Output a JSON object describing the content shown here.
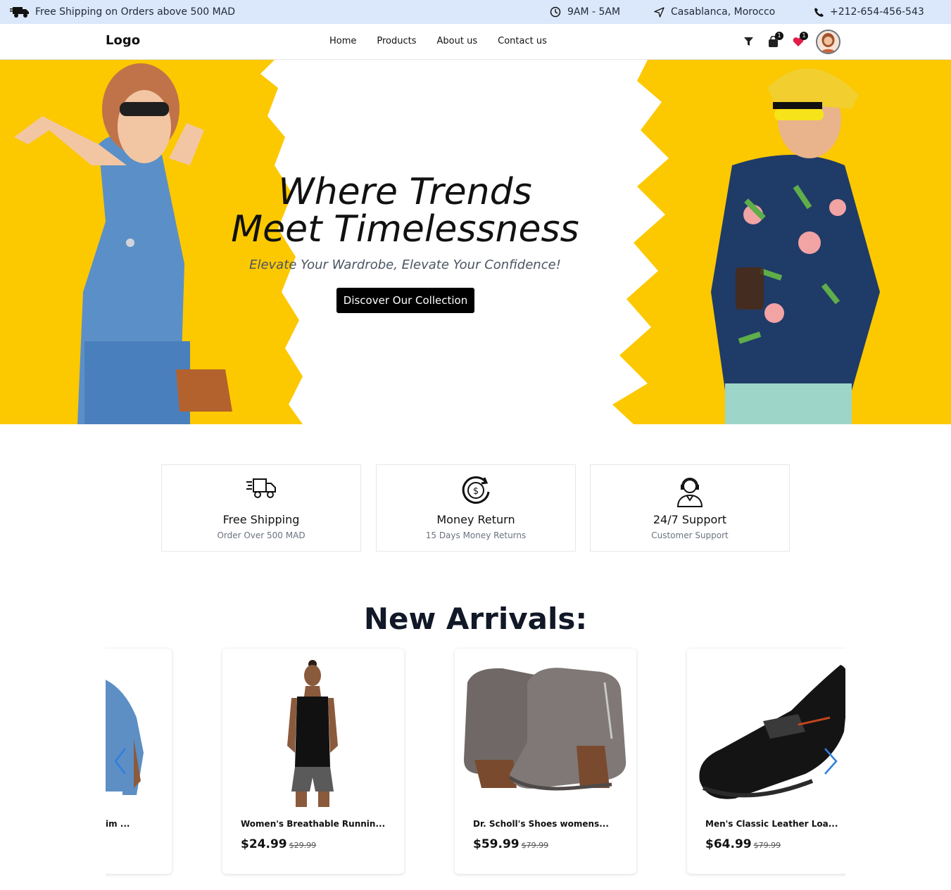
{
  "topbar": {
    "shipping_text": "Free Shipping on Orders above 500 MAD",
    "hours": "9AM - 5AM",
    "location": "Casablanca, Morocco",
    "phone": "+212-654-456-543"
  },
  "nav": {
    "logo": "Logo",
    "links": [
      "Home",
      "Products",
      "About us",
      "Contact us"
    ],
    "cart_count": "1",
    "wishlist_count": "1"
  },
  "hero": {
    "title_line1": "Where Trends",
    "title_line2": "Meet Timelessness",
    "subtitle": "Elevate Your Wardrobe, Elevate Your Confidence!",
    "cta": "Discover Our Collection"
  },
  "features": [
    {
      "icon": "delivery-truck-icon",
      "title": "Free Shipping",
      "subtitle": "Order Over 500 MAD"
    },
    {
      "icon": "money-return-icon",
      "title": "Money Return",
      "subtitle": "15 Days Money Returns"
    },
    {
      "icon": "support-agent-icon",
      "title": "24/7 Support",
      "subtitle": "Customer Support"
    }
  ],
  "arrivals": {
    "title": "New Arrivals:",
    "products": [
      {
        "name": "im ...",
        "price": "",
        "old_price": ""
      },
      {
        "name": "Women's Breathable Runnin...",
        "price": "$24.99",
        "old_price": "$29.99"
      },
      {
        "name": "Dr. Scholl's Shoes womens...",
        "price": "$59.99",
        "old_price": "$79.99"
      },
      {
        "name": "Men's Classic Leather Loa...",
        "price": "$64.99",
        "old_price": "$79.99"
      }
    ]
  },
  "colors": {
    "topbar_bg": "#dbe7fb",
    "hero_yellow": "#fcc800",
    "arrow_blue": "#2f7fe0"
  }
}
